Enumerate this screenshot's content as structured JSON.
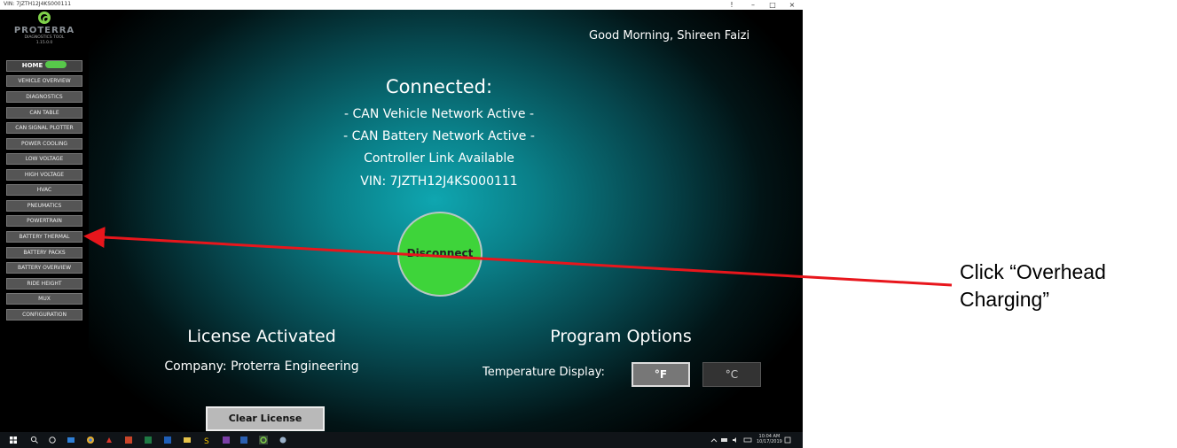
{
  "window": {
    "title": "VIN: 7JZTH12J4KS000111",
    "controls": [
      "!",
      "–",
      "□",
      "×"
    ]
  },
  "sidebar": {
    "brand": "PROTERRA",
    "subtitle": "DIAGNOSTICS TOOL",
    "version": "1.15.0.0",
    "items": [
      {
        "label": "HOME"
      },
      {
        "label": "VEHICLE OVERVIEW"
      },
      {
        "label": "DIAGNOSTICS"
      },
      {
        "label": "CAN TABLE"
      },
      {
        "label": "CAN SIGNAL PLOTTER"
      },
      {
        "label": "POWER COOLING"
      },
      {
        "label": "LOW VOLTAGE"
      },
      {
        "label": "HIGH VOLTAGE"
      },
      {
        "label": "HVAC"
      },
      {
        "label": "PNEUMATICS"
      },
      {
        "label": "POWERTRAIN"
      },
      {
        "label": "BATTERY THERMAL"
      },
      {
        "label": "BATTERY PACKS"
      },
      {
        "label": "BATTERY OVERVIEW"
      },
      {
        "label": "RIDE HEIGHT"
      },
      {
        "label": "MUX"
      },
      {
        "label": "CONFIGURATION"
      }
    ]
  },
  "main": {
    "greeting": "Good Morning, Shireen Faizi",
    "connected_title": "Connected:",
    "status_lines": [
      "- CAN Vehicle Network Active -",
      "- CAN Battery Network Active -",
      "Controller Link Available",
      "VIN: 7JZTH12J4KS000111"
    ],
    "disconnect_label": "Disconnect",
    "license_title": "License Activated",
    "license_company": "Company: Proterra Engineering",
    "clear_license_label": "Clear License",
    "program_options_title": "Program Options",
    "temperature_label": "Temperature Display:",
    "fahrenheit_label": "°F",
    "celsius_label": "°C"
  },
  "taskbar": {
    "time": "10:04 AM",
    "date": "10/17/2019"
  },
  "annotation": {
    "line1": "Click “Overhead",
    "line2": "Charging”",
    "color": "#e8161c"
  },
  "colors": {
    "accent_green": "#3ed43a",
    "teal_glow": "#0fa6b0"
  }
}
